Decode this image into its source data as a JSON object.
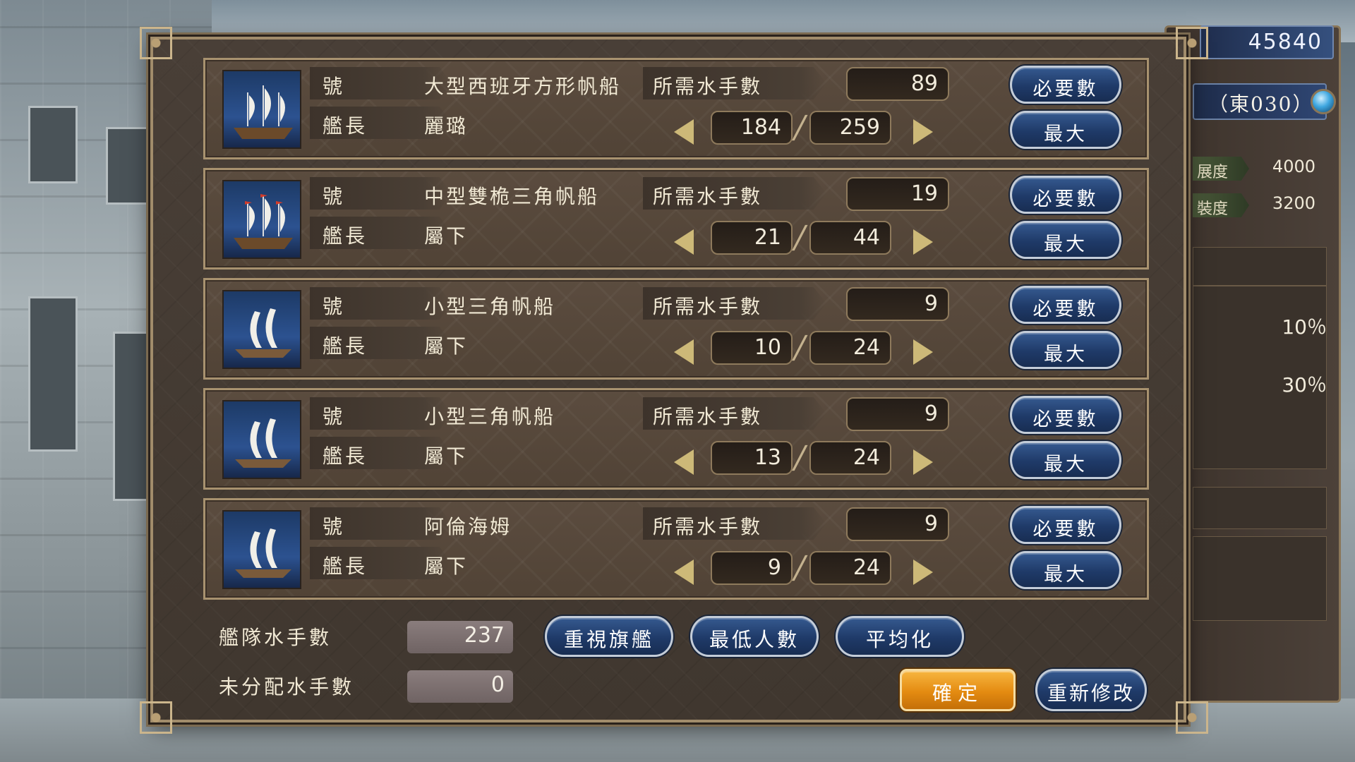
{
  "hud": {
    "gold": "45840",
    "location": "（東030）",
    "stats": [
      {
        "label": "展度",
        "value": "4000"
      },
      {
        "label": "裝度",
        "value": "3200"
      }
    ],
    "percents": [
      "10％",
      "30％"
    ]
  },
  "ship_labels": {
    "name_tag": "號",
    "captain_tag": "艦長",
    "crew_required": "所需水手數",
    "btn_required": "必要數",
    "btn_max": "最大"
  },
  "ships": [
    {
      "name": "大型西班牙方形帆船",
      "captain": "麗璐",
      "required": "89",
      "current": "184",
      "max": "259",
      "icon": "three-mast-ship-icon"
    },
    {
      "name": "中型雙桅三角帆船",
      "captain": "屬下",
      "required": "19",
      "current": "21",
      "max": "44",
      "icon": "three-mast-ship-icon"
    },
    {
      "name": "小型三角帆船",
      "captain": "屬下",
      "required": "9",
      "current": "10",
      "max": "24",
      "icon": "lateen-sail-ship-icon"
    },
    {
      "name": "小型三角帆船",
      "captain": "屬下",
      "required": "9",
      "current": "13",
      "max": "24",
      "icon": "lateen-sail-ship-icon"
    },
    {
      "name": "阿倫海姆",
      "captain": "屬下",
      "required": "9",
      "current": "9",
      "max": "24",
      "icon": "lateen-sail-ship-icon"
    }
  ],
  "fleet": {
    "total_label": "艦隊水手數",
    "total_value": "237",
    "unassigned_label": "未分配水手數",
    "unassigned_value": "0"
  },
  "actions": {
    "prioritize_flagship": "重視旗艦",
    "minimum": "最低人數",
    "average": "平均化",
    "confirm": "確定",
    "reset": "重新修改"
  },
  "colors": {
    "panel_bg": "#4a3f35",
    "frame_gold": "#a8926f",
    "button_blue": "#1f3a68",
    "confirm_orange": "#e48b11"
  }
}
